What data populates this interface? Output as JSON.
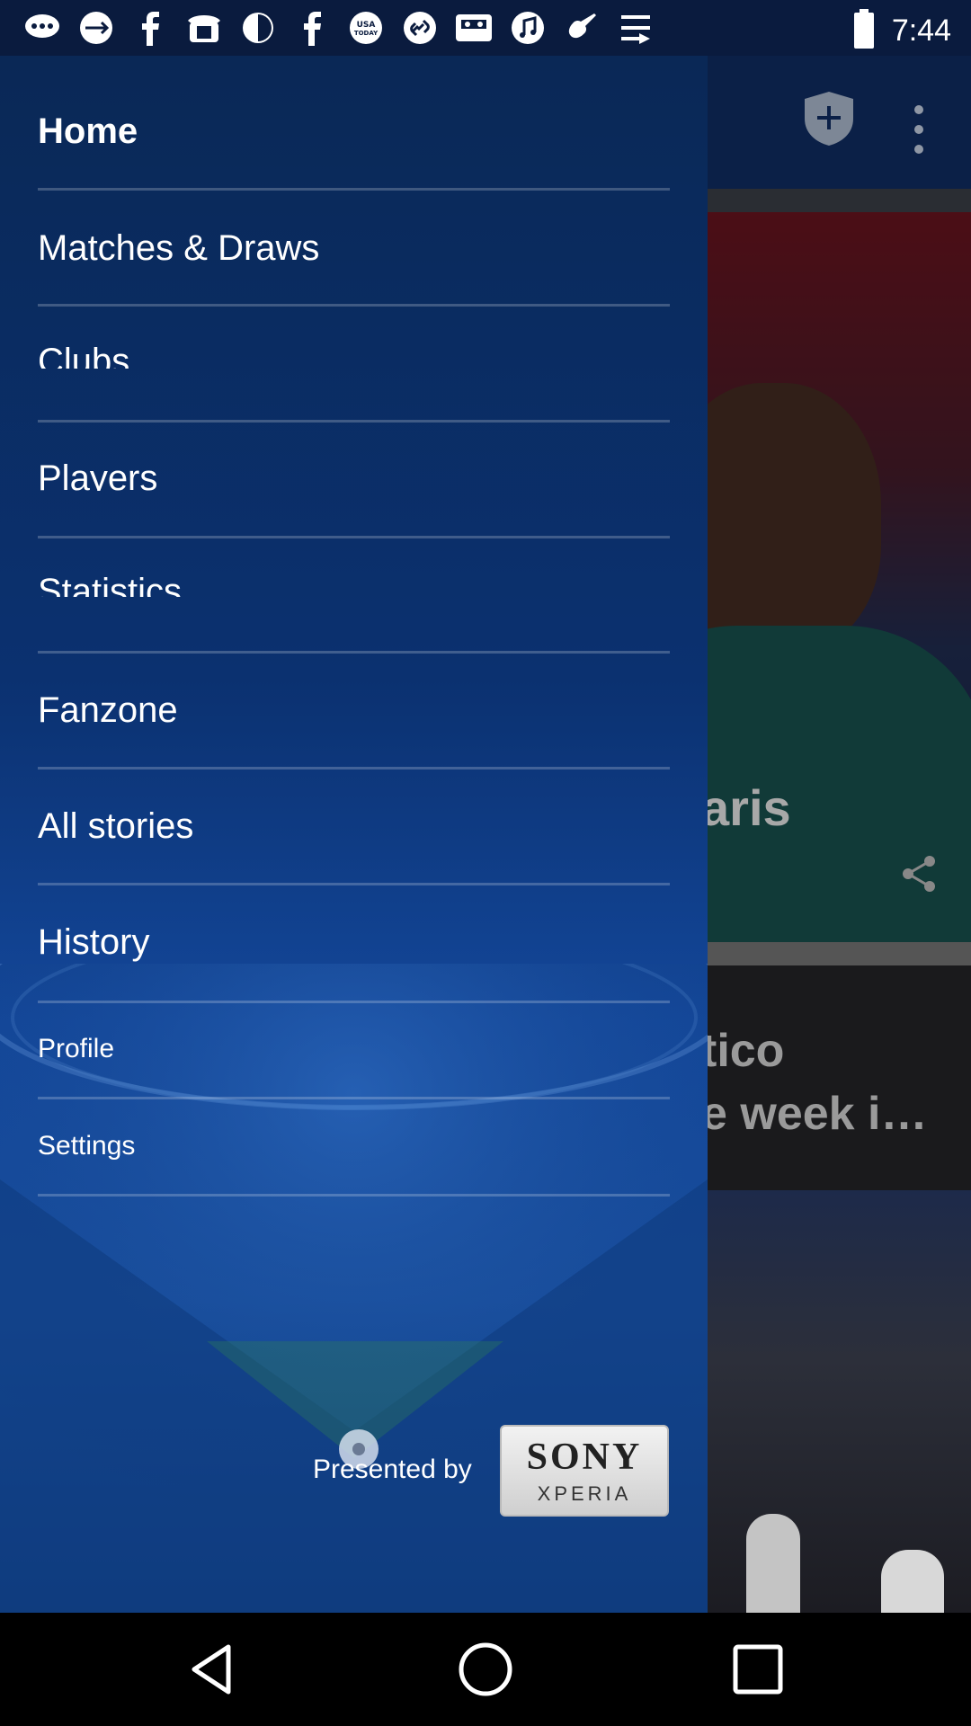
{
  "status_bar": {
    "time": "7:44",
    "notification_icons": [
      "chat-bubble-icon",
      "usb-icon",
      "facebook-icon",
      "phone-icon",
      "brightness-icon",
      "facebook-icon",
      "usa-today-icon",
      "link-icon",
      "cassette-icon",
      "music-icon",
      "guitar-icon",
      "play-store-icon"
    ],
    "battery_icon": "battery-icon"
  },
  "drawer": {
    "items": [
      {
        "label": "Home",
        "name": "drawer-item-home"
      },
      {
        "label": "Matches & Draws",
        "name": "drawer-item-matches-draws"
      },
      {
        "label": "Clubs",
        "name": "drawer-item-clubs"
      },
      {
        "label": "Players",
        "name": "drawer-item-players"
      },
      {
        "label": "Statistics",
        "name": "drawer-item-statistics"
      },
      {
        "label": "Fanzone",
        "name": "drawer-item-fanzone"
      },
      {
        "label": "All stories",
        "name": "drawer-item-all-stories"
      },
      {
        "label": "History",
        "name": "drawer-item-history"
      },
      {
        "label": "Profile",
        "name": "drawer-item-profile"
      },
      {
        "label": "Settings",
        "name": "drawer-item-settings"
      }
    ],
    "presented_by": "Presented by",
    "sponsor": {
      "brand": "SONY",
      "product": "XPERIA"
    }
  },
  "background_app": {
    "card1_title_fragment": "aris",
    "card2_title_fragment": "tico\ne week i…"
  },
  "colors": {
    "drawer_top": "#0a2856",
    "drawer_bottom": "#184e9e",
    "toolbar": "#0b2047"
  }
}
